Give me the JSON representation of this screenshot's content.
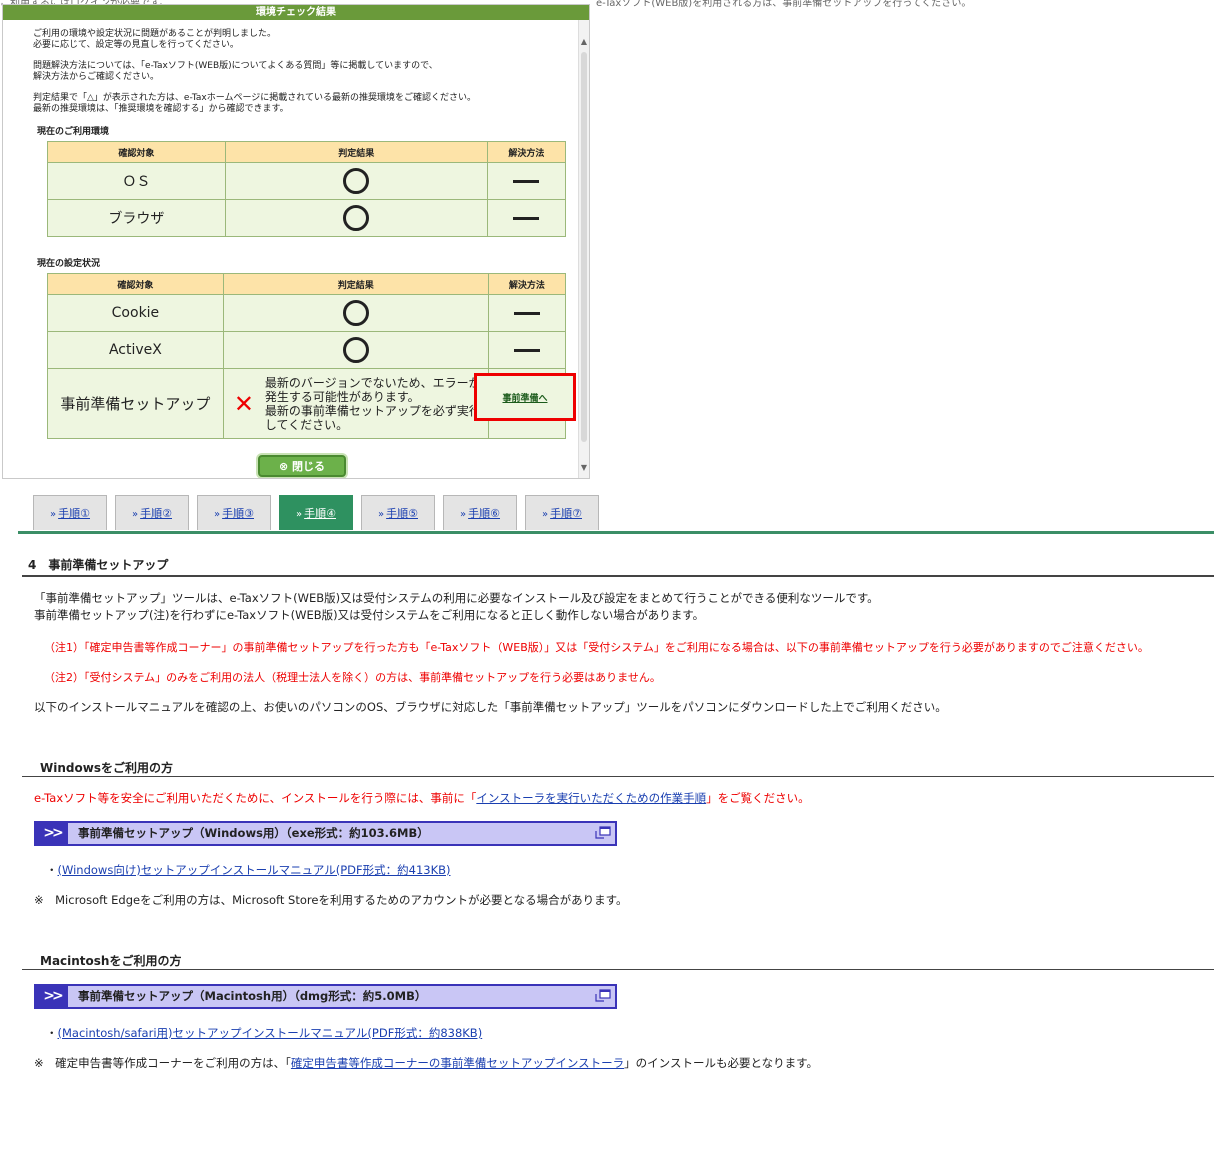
{
  "background": {
    "fragment_left": "ご利用するにはログインが必要です。",
    "fragment_right": "e-Taxソフト(WEB版)を利用される方は、事前準備セットアップを行ってください。"
  },
  "popup": {
    "title": "環境チェック結果",
    "intro1": "ご利用の環境や設定状況に問題があることが判明しました。",
    "intro2": "必要に応じて、設定等の見直しを行ってください。",
    "help1": "問題解決方法については、「e-Taxソフト(WEB版)についてよくある質問」等に掲載していますので、",
    "help2": "解決方法からご確認ください。",
    "note1": "判定結果で「△」が表示された方は、e-Taxホームページに掲載されている最新の推奨環境をご確認ください。",
    "note2": "最新の推奨環境は、「推奨環境を確認する」から確認できます。",
    "section1_title": "現在のご利用環境",
    "section2_title": "現在の設定状況",
    "col_target": "確認対象",
    "col_result": "判定結果",
    "col_solution": "解決方法",
    "env_rows": [
      {
        "target": "ＯＳ"
      },
      {
        "target": "ブラウザ"
      }
    ],
    "set_rows": [
      {
        "target": "Cookie"
      },
      {
        "target": "ActiveX"
      },
      {
        "target": "事前準備セットアップ"
      }
    ],
    "warn_line1": "最新のバージョンでないため、エラーが",
    "warn_line2": "発生する可能性があります。",
    "warn_line3": "最新の事前準備セットアップを必ず実行",
    "warn_line4": "してください。",
    "prep_link": "事前準備へ",
    "close_button": "閉じる"
  },
  "tabs": [
    {
      "label": "手順①"
    },
    {
      "label": "手順②"
    },
    {
      "label": "手順③"
    },
    {
      "label": "手順④",
      "active": true
    },
    {
      "label": "手順⑤"
    },
    {
      "label": "手順⑥"
    },
    {
      "label": "手順⑦"
    }
  ],
  "main": {
    "section_title": "4　事前準備セットアップ",
    "p1": "「事前準備セットアップ」ツールは、e-Taxソフト(WEB版)又は受付システムの利用に必要なインストール及び設定をまとめて行うことができる便利なツールです。",
    "p2": "事前準備セットアップ(注)を行わずにe-Taxソフト(WEB版)又は受付システムをご利用になると正しく動作しない場合があります。",
    "note1": "（注1）「確定申告書等作成コーナー」の事前準備セットアップを行った方も「e-Taxソフト（WEB版）」又は「受付システム」をご利用になる場合は、以下の事前準備セットアップを行う必要がありますのでご注意ください。",
    "note2": "（注2）「受付システム」のみをご利用の法人（税理士法人を除く）の方は、事前準備セットアップを行う必要はありません。",
    "p3": "以下のインストールマニュアルを確認の上、お使いのパソコンのOS、ブラウザに対応した「事前準備セットアップ」ツールをパソコンにダウンロードした上でご利用ください。",
    "win_heading": "Windowsをご利用の方",
    "win_warn_pre": "e-Taxソフト等を安全にご利用いただくために、インストールを行う際には、事前に「",
    "win_warn_link": "インストーラを実行いただくための作業手順",
    "win_warn_post": "」をご覧ください。",
    "win_download": "事前準備セットアップ（Windows用）（exe形式：約103.6MB）",
    "win_manual": "(Windows向け)セットアップインストールマニュアル(PDF形式：約413KB)",
    "win_note": "※　Microsoft Edgeをご利用の方は、Microsoft Storeを利用するためのアカウントが必要となる場合があります。",
    "mac_heading": "Macintoshをご利用の方",
    "mac_download": "事前準備セットアップ（Macintosh用）（dmg形式：約5.0MB）",
    "mac_manual": "(Macintosh/safari用)セットアップインストールマニュアル(PDF形式：約838KB)",
    "mac_note_pre": "※　確定申告書等作成コーナーをご利用の方は、「",
    "mac_note_link": "確定申告書等作成コーナーの事前準備セットアップインストーラ",
    "mac_note_post": "」のインストールも必要となります。",
    "bullet": "・"
  }
}
